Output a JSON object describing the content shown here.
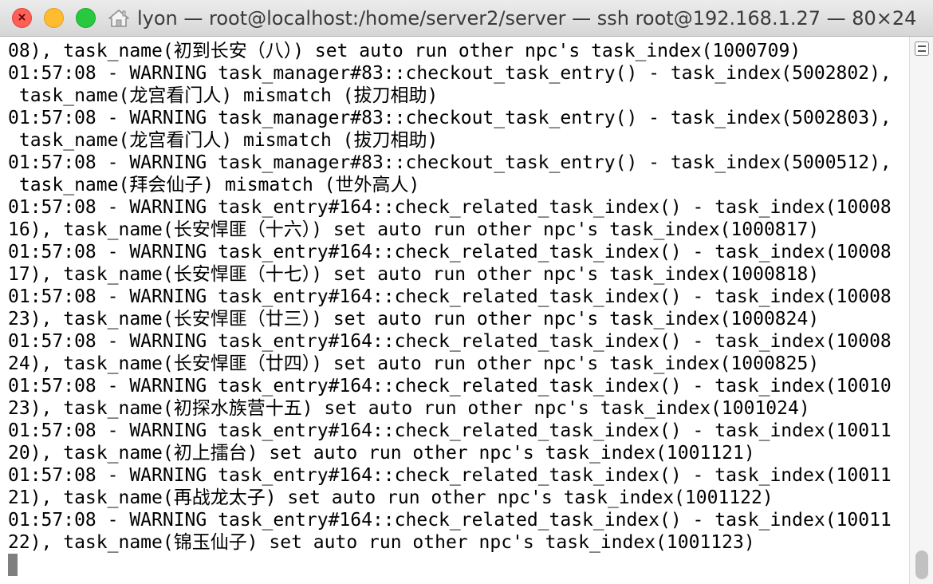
{
  "window": {
    "title": "lyon — root@localhost:/home/server2/server — ssh root@192.168.1.27 — 80×24",
    "icons": {
      "close": "close-icon",
      "minimize": "minimize-icon",
      "zoom": "zoom-icon",
      "title_icon": "home-folder-icon",
      "scroll_menu": "menu-lines-icon"
    },
    "colors": {
      "close": "#fe5f57",
      "minimize": "#febc2e",
      "zoom": "#28c840"
    }
  },
  "terminal": {
    "lines": [
      "08), task_name(初到长安（八）) set auto run other npc's task_index(1000709)",
      "01:57:08 - WARNING task_manager#83::checkout_task_entry() - task_index(5002802),",
      " task_name(龙宫看门人) mismatch (拔刀相助)",
      "01:57:08 - WARNING task_manager#83::checkout_task_entry() - task_index(5002803),",
      " task_name(龙宫看门人) mismatch (拔刀相助)",
      "01:57:08 - WARNING task_manager#83::checkout_task_entry() - task_index(5000512),",
      " task_name(拜会仙子) mismatch (世外高人)",
      "01:57:08 - WARNING task_entry#164::check_related_task_index() - task_index(10008",
      "16), task_name(长安悍匪（十六）) set auto run other npc's task_index(1000817)",
      "01:57:08 - WARNING task_entry#164::check_related_task_index() - task_index(10008",
      "17), task_name(长安悍匪（十七）) set auto run other npc's task_index(1000818)",
      "01:57:08 - WARNING task_entry#164::check_related_task_index() - task_index(10008",
      "23), task_name(长安悍匪（廿三）) set auto run other npc's task_index(1000824)",
      "01:57:08 - WARNING task_entry#164::check_related_task_index() - task_index(10008",
      "24), task_name(长安悍匪（廿四）) set auto run other npc's task_index(1000825)",
      "01:57:08 - WARNING task_entry#164::check_related_task_index() - task_index(10010",
      "23), task_name(初探水族营十五) set auto run other npc's task_index(1001024)",
      "01:57:08 - WARNING task_entry#164::check_related_task_index() - task_index(10011",
      "20), task_name(初上擂台) set auto run other npc's task_index(1001121)",
      "01:57:08 - WARNING task_entry#164::check_related_task_index() - task_index(10011",
      "21), task_name(再战龙太子) set auto run other npc's task_index(1001122)",
      "01:57:08 - WARNING task_entry#164::check_related_task_index() - task_index(10011",
      "22), task_name(锦玉仙子) set auto run other npc's task_index(1001123)"
    ]
  }
}
